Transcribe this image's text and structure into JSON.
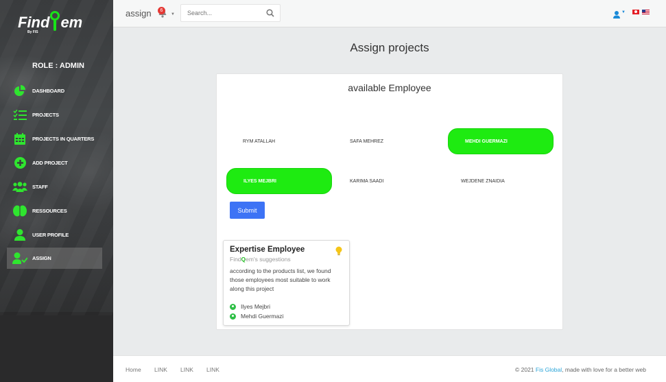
{
  "app": {
    "logo_prefix": "Find",
    "logo_suffix": "em",
    "logo_sub": "By FIS"
  },
  "sidebar": {
    "role": "ROLE : ADMIN",
    "items": [
      {
        "label": "DASHBOARD",
        "icon": "pie-chart-icon"
      },
      {
        "label": "PROJECTS",
        "icon": "checklist-icon"
      },
      {
        "label": "PROJECTS IN QUARTERS",
        "icon": "calendar-icon"
      },
      {
        "label": "ADD PROJECT",
        "icon": "plus-circle-icon"
      },
      {
        "label": "STAFF",
        "icon": "users-icon"
      },
      {
        "label": "RESSOURCES",
        "icon": "brain-icon"
      },
      {
        "label": "USER PROFILE",
        "icon": "user-icon"
      },
      {
        "label": "ASSIGN",
        "icon": "user-check-icon",
        "active": true
      }
    ]
  },
  "topbar": {
    "title": "assign",
    "notification_count": "6",
    "search_placeholder": "Search..."
  },
  "main": {
    "page_title": "Assign projects",
    "card_title": "available Employee",
    "employees": [
      {
        "name": "RYM ATALLAH",
        "selected": false
      },
      {
        "name": "SAFA MEHREZ",
        "selected": false
      },
      {
        "name": "MEHDI GUERMAZI",
        "selected": true
      },
      {
        "name": "ILYES MEJBRI",
        "selected": true
      },
      {
        "name": "KARIMA SAADI",
        "selected": false
      },
      {
        "name": "WEJDENE ZNAIDIA",
        "selected": false
      }
    ],
    "submit_label": "Submit",
    "suggestions": {
      "title": "Expertise Employee",
      "subtitle_a": "Find",
      "subtitle_b": "em's suggestions",
      "text": "according to the products list, we found those employees most suitable to work along this project",
      "people": [
        "Ilyes Mejbri",
        "Mehdi Guermazi"
      ]
    }
  },
  "footer": {
    "links": [
      "Home",
      "LINK",
      "LINK",
      "LINK"
    ],
    "copyright_prefix": "© 2021 ",
    "brand": "Fis Global",
    "copyright_suffix": ", made with love for a better web"
  },
  "colors": {
    "accent_green": "#1eeb11",
    "submit_blue": "#3d73f5",
    "brand_link": "#2aa4d8"
  }
}
